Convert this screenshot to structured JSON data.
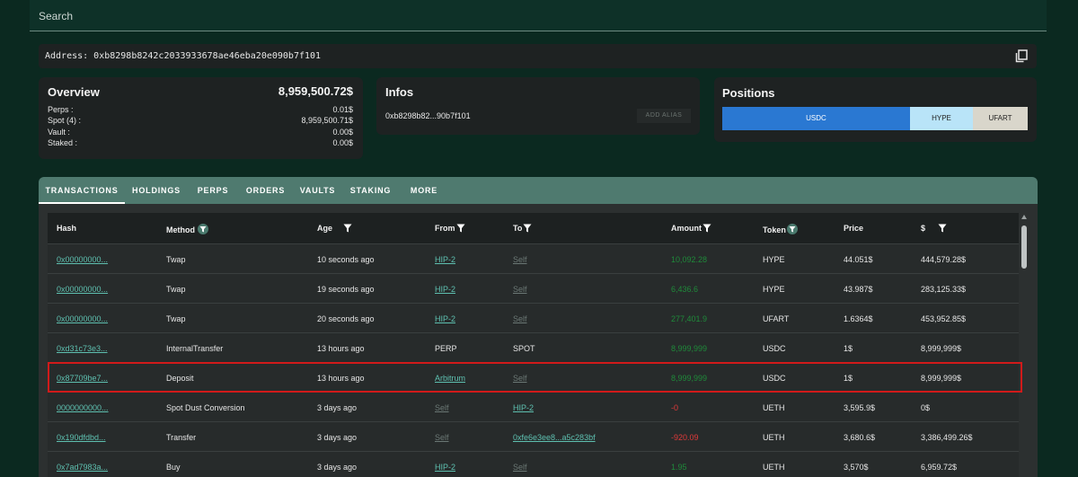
{
  "search": {
    "label": "Search"
  },
  "address": {
    "text": "Address: 0xb8298b8242c2033933678ae46eba20e090b7f101"
  },
  "overview": {
    "title": "Overview",
    "total": "8,959,500.72$",
    "rows": [
      {
        "label": "Perps :",
        "value": "0.01$"
      },
      {
        "label": "Spot (4) :",
        "value": "8,959,500.71$"
      },
      {
        "label": "Vault :",
        "value": "0.00$"
      },
      {
        "label": "Staked :",
        "value": "0.00$"
      }
    ]
  },
  "infos": {
    "title": "Infos",
    "address_short": "0xb8298b82...90b7f101",
    "alias_button": "ADD ALIAS"
  },
  "positions": {
    "title": "Positions",
    "bars": [
      {
        "label": "USDC",
        "color": "#2a78d2"
      },
      {
        "label": "HYPE",
        "color": "#b9e4f8"
      },
      {
        "label": "UFART",
        "color": "#d9d6cb"
      }
    ]
  },
  "tabs": [
    "TRANSACTIONS",
    "HOLDINGS",
    "PERPS",
    "ORDERS",
    "VAULTS",
    "STAKING",
    "MORE"
  ],
  "table": {
    "headers": {
      "hash": "Hash",
      "method": "Method",
      "age": "Age",
      "from": "From",
      "to": "To",
      "amount": "Amount",
      "token": "Token",
      "price": "Price",
      "usd": "$"
    },
    "rows": [
      {
        "hash": "0x00000000...",
        "method": "Twap",
        "age": "10 seconds ago",
        "from": "HIP-2",
        "to": "Self",
        "amount": "10,092.28",
        "token": "HYPE",
        "price": "44.051$",
        "usd": "444,579.28$"
      },
      {
        "hash": "0x00000000...",
        "method": "Twap",
        "age": "19 seconds ago",
        "from": "HIP-2",
        "to": "Self",
        "amount": "6,436.6",
        "token": "HYPE",
        "price": "43.987$",
        "usd": "283,125.33$"
      },
      {
        "hash": "0x00000000...",
        "method": "Twap",
        "age": "20 seconds ago",
        "from": "HIP-2",
        "to": "Self",
        "amount": "277,401.9",
        "token": "UFART",
        "price": "1.6364$",
        "usd": "453,952.85$"
      },
      {
        "hash": "0xd31c73e3...",
        "method": "InternalTransfer",
        "age": "13 hours ago",
        "from": "PERP",
        "to": "SPOT",
        "amount": "8,999,999",
        "token": "USDC",
        "price": "1$",
        "usd": "8,999,999$"
      },
      {
        "hash": "0x87709be7...",
        "method": "Deposit",
        "age": "13 hours ago",
        "from": "Arbitrum",
        "to": "Self",
        "amount": "8,999,999",
        "token": "USDC",
        "price": "1$",
        "usd": "8,999,999$"
      },
      {
        "hash": "0000000000...",
        "method": "Spot Dust Conversion",
        "age": "3 days ago",
        "from": "Self",
        "to": "HIP-2",
        "amount": "-0",
        "token": "UETH",
        "price": "3,595.9$",
        "usd": "0$"
      },
      {
        "hash": "0x190dfdbd...",
        "method": "Transfer",
        "age": "3 days ago",
        "from": "Self",
        "to": "0xfe6e3ee8...a5c283bf",
        "amount": "-920.09",
        "token": "UETH",
        "price": "3,680.6$",
        "usd": "3,386,499.26$"
      },
      {
        "hash": "0x7ad7983a...",
        "method": "Buy",
        "age": "3 days ago",
        "from": "HIP-2",
        "to": "Self",
        "amount": "1.95",
        "token": "UETH",
        "price": "3,570$",
        "usd": "6,959.72$"
      }
    ]
  }
}
